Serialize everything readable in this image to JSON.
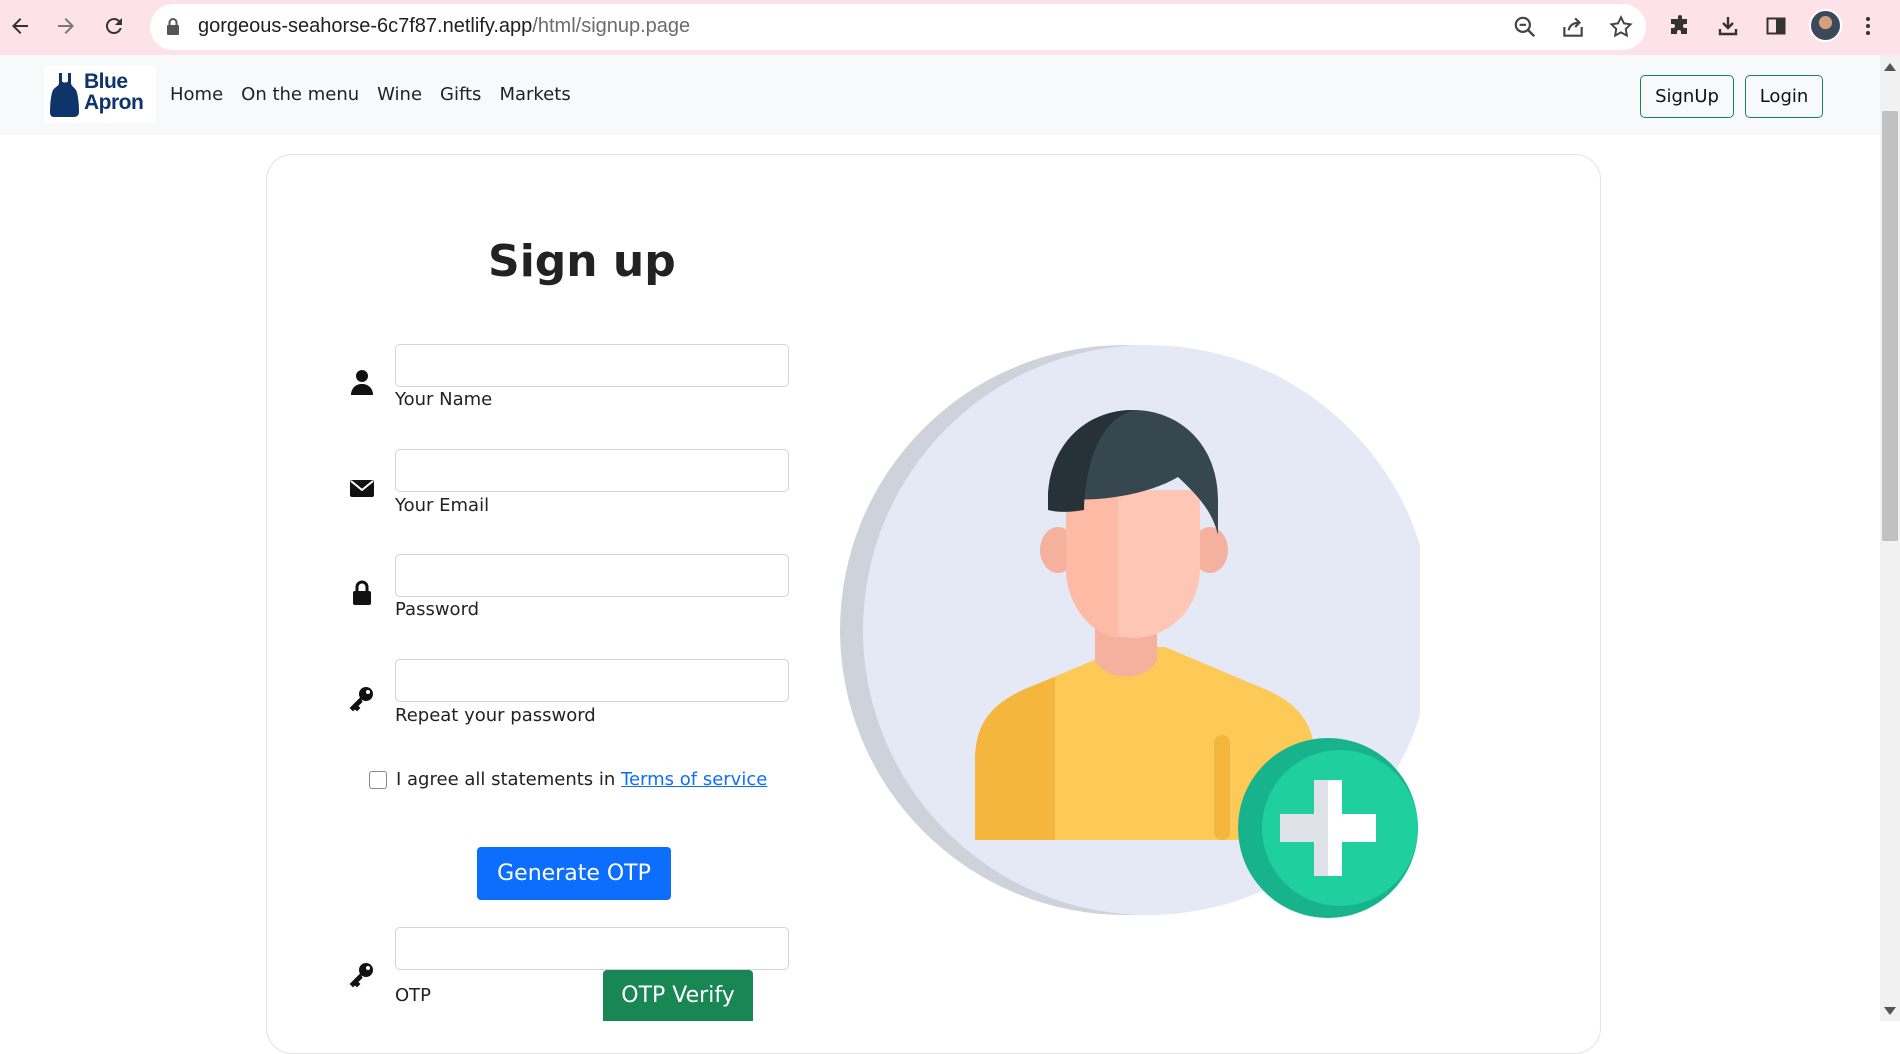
{
  "browser": {
    "url_host": "gorgeous-seahorse-6c7f87.netlify.app",
    "url_path": "/html/signup.page"
  },
  "navbar": {
    "logo": {
      "line1": "Blue",
      "line2": "Apron",
      "color": "#0f346c"
    },
    "links": [
      {
        "label": "Home"
      },
      {
        "label": "On the menu"
      },
      {
        "label": "Wine"
      },
      {
        "label": "Gifts"
      },
      {
        "label": "Markets"
      }
    ],
    "signup_label": "SignUp",
    "login_label": "Login"
  },
  "form": {
    "title": "Sign up",
    "fields": [
      {
        "label": "Your Name",
        "value": "",
        "icon": "user-icon"
      },
      {
        "label": "Your Email",
        "value": "",
        "icon": "envelope-icon"
      },
      {
        "label": "Password",
        "value": "",
        "icon": "lock-icon"
      },
      {
        "label": "Repeat your password",
        "value": "",
        "icon": "key-icon"
      }
    ],
    "agree": {
      "text": "I agree all statements in ",
      "link": "Terms of service",
      "checked": false
    },
    "generate_otp_label": "Generate OTP",
    "otp": {
      "label": "OTP",
      "value": "",
      "icon": "key-icon"
    },
    "verify_label": "OTP Verify"
  },
  "colors": {
    "primary": "#0d6efd",
    "success": "#198754",
    "browser_bar": "#fde2ea",
    "navbar_bg": "#f8f9fa"
  }
}
